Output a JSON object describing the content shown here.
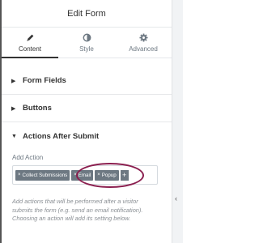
{
  "header": {
    "title": "Edit Form"
  },
  "tabs": [
    {
      "label": "Content",
      "icon": "pencil-icon",
      "active": true
    },
    {
      "label": "Style",
      "icon": "half-circle-icon",
      "active": false
    },
    {
      "label": "Advanced",
      "icon": "gear-icon",
      "active": false
    }
  ],
  "sections": [
    {
      "label": "Form Fields",
      "expanded": false
    },
    {
      "label": "Buttons",
      "expanded": false
    },
    {
      "label": "Actions After Submit",
      "expanded": true
    }
  ],
  "actions_after_submit": {
    "add_action_label": "Add Action",
    "selected_actions": [
      "Collect Submissions",
      "Email",
      "Popup"
    ],
    "add_button_label": "+",
    "remove_glyph": "×",
    "help_text": "Add actions that will be performed after a visitor submits the form (e.g. send an email notification). Choosing an action will add its setting below."
  },
  "glyphs": {
    "caret_collapsed": "▶",
    "caret_expanded": "▼",
    "panel_collapse": "‹"
  },
  "colors": {
    "chip_background": "#6d7882",
    "highlight_ring": "#8b1f4f",
    "active_tab": "#333333",
    "inactive_tab": "#6d7882"
  }
}
